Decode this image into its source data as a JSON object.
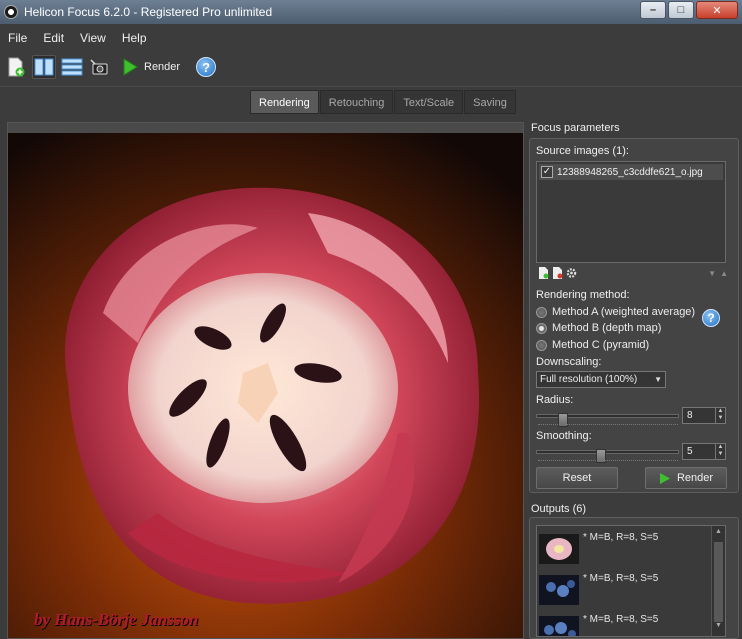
{
  "window": {
    "title": "Helicon Focus 6.2.0 - Registered Pro unlimited",
    "buttons": {
      "minimize": "–",
      "maximize": "□",
      "close": "✕"
    }
  },
  "menu": [
    "File",
    "Edit",
    "View",
    "Help"
  ],
  "toolbar": {
    "render_label": "Render",
    "help": "?"
  },
  "tabs": [
    {
      "label": "Rendering",
      "active": true
    },
    {
      "label": "Retouching",
      "active": false
    },
    {
      "label": "Text/Scale",
      "active": false
    },
    {
      "label": "Saving",
      "active": false
    }
  ],
  "preview": {
    "credit": "by Hans-Börje Jansson"
  },
  "focus": {
    "title": "Focus parameters",
    "source_label": "Source images (1):",
    "source_files": [
      {
        "name": "12388948265_c3cddfe621_o.jpg",
        "checked": true
      }
    ],
    "checkmark": "✓",
    "rendering_method_label": "Rendering method:",
    "methods": [
      {
        "label": "Method A (weighted average)",
        "selected": false
      },
      {
        "label": "Method B (depth map)",
        "selected": true
      },
      {
        "label": "Method C (pyramid)",
        "selected": false
      }
    ],
    "downscaling_label": "Downscaling:",
    "downscaling_value": "Full resolution (100%)",
    "radius_label": "Radius:",
    "radius_value": "8",
    "radius_fraction": 0.16,
    "smoothing_label": "Smoothing:",
    "smoothing_value": "5",
    "smoothing_fraction": 0.44,
    "reset_label": "Reset",
    "render_label": "Render",
    "help": "?"
  },
  "outputs": {
    "title": "Outputs (6)",
    "items": [
      {
        "label": "* M=B, R=8, S=5"
      },
      {
        "label": "* M=B, R=8, S=5"
      },
      {
        "label": "* M=B, R=8, S=5"
      }
    ]
  },
  "colors": {
    "accent_green": "#3fbf2f",
    "help_blue": "#1f6fc4",
    "credit_red": "#b41a2a"
  }
}
